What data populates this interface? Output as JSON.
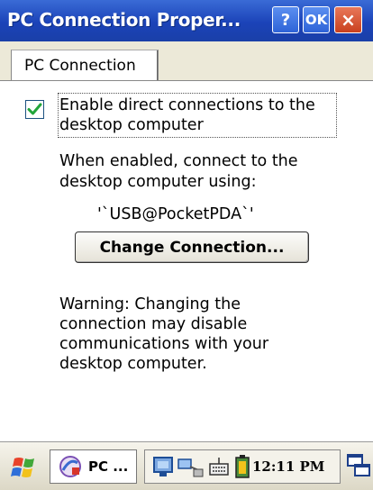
{
  "window": {
    "title": "PC Connection Proper...",
    "help_label": "?",
    "ok_label": "OK",
    "close_label": "×"
  },
  "tabs": [
    {
      "label": "PC Connection",
      "selected": true
    }
  ],
  "settings": {
    "checkbox_checked": true,
    "checkbox_label_line1": "Enable direct connections to the",
    "checkbox_label_line2": "desktop computer",
    "info_line1": "When enabled, connect to the",
    "info_line2": "desktop computer using:",
    "connection_value": "'`USB@PocketPDA`'",
    "change_button": "Change Connection...",
    "warning_line1": "Warning: Changing the",
    "warning_line2": "connection may disable",
    "warning_line3": "communications with your",
    "warning_line4": "desktop computer."
  },
  "taskbar": {
    "start_icon": "windows-flag-icon",
    "task_label": "PC ...",
    "clock": "12:11 PM",
    "tray_icons": [
      "network-icon",
      "connection-icon",
      "keyboard-icon",
      "battery-icon"
    ]
  },
  "colors": {
    "titlebar": "#1b43b8",
    "check": "#22a53a",
    "close_button": "#c9401e"
  }
}
